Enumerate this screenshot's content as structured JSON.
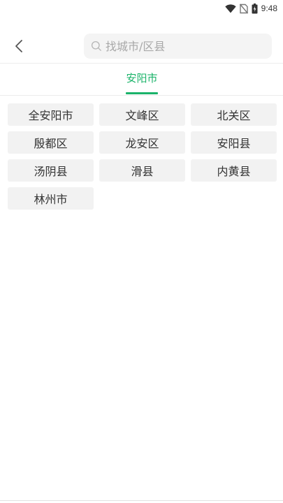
{
  "status_bar": {
    "time": "9:48",
    "icons": [
      "wifi-icon",
      "no-sim-icon",
      "battery-icon"
    ]
  },
  "header": {
    "back_icon": "chevron-left-icon",
    "search": {
      "icon": "search-icon",
      "placeholder": "找城市/区县",
      "value": ""
    }
  },
  "tabs": {
    "active_label": "安阳市"
  },
  "districts": [
    "全安阳市",
    "文峰区",
    "北关区",
    "殷都区",
    "龙安区",
    "安阳县",
    "汤阴县",
    "滑县",
    "内黄县",
    "林州市"
  ],
  "colors": {
    "accent": "#1bb36a",
    "item_background": "#f2f2f2",
    "search_background": "#f4f4f4"
  }
}
